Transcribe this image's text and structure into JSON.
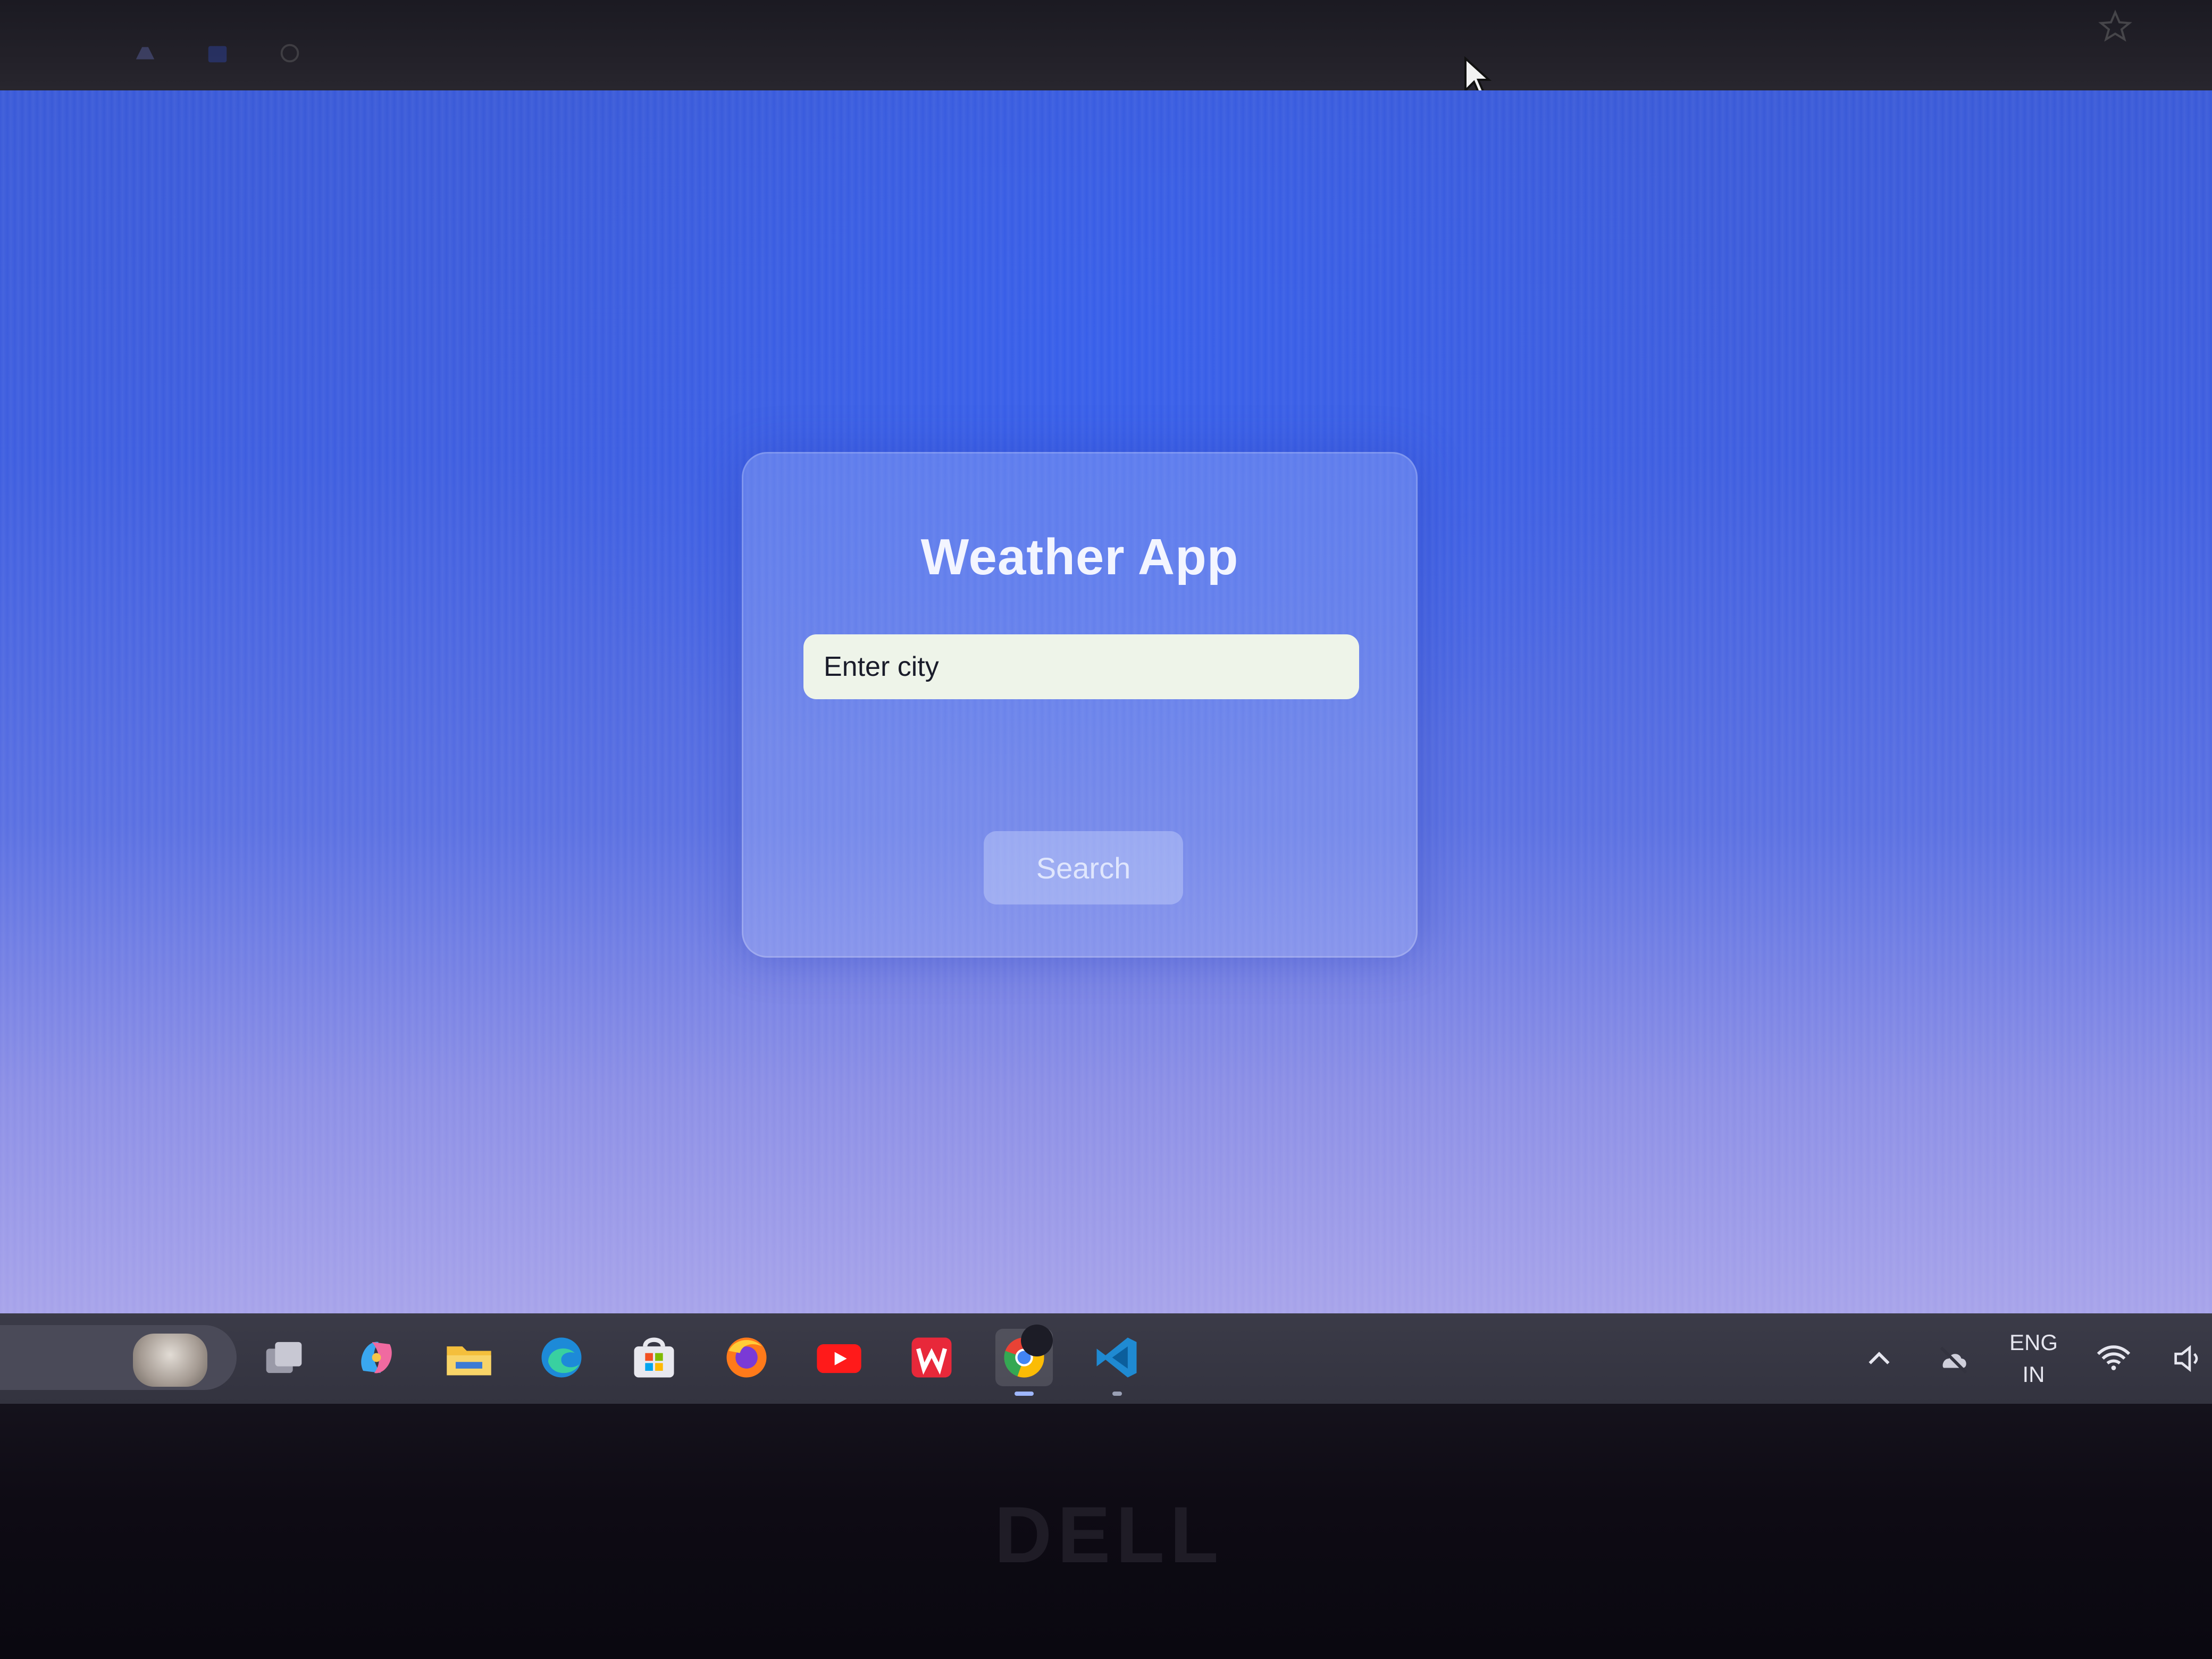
{
  "window": {
    "title": "Weather App"
  },
  "app": {
    "title": "Weather App",
    "city_input_placeholder": "Enter city",
    "search_label": "Search"
  },
  "taskbar": {
    "apps": [
      "task-view",
      "copilot",
      "file-explorer",
      "edge",
      "microsoft-store",
      "firefox",
      "youtube",
      "wps-office",
      "chrome",
      "vscode"
    ],
    "active_app": "chrome"
  },
  "tray": {
    "lang_primary": "ENG",
    "lang_secondary": "IN"
  },
  "device": {
    "brand": "DELL"
  },
  "colors": {
    "background_top": "#3a5ad8",
    "background_bottom": "#a7a3ea",
    "input_bg": "#eef4e9",
    "card_bg": "rgba(190,205,255,0.28)"
  }
}
